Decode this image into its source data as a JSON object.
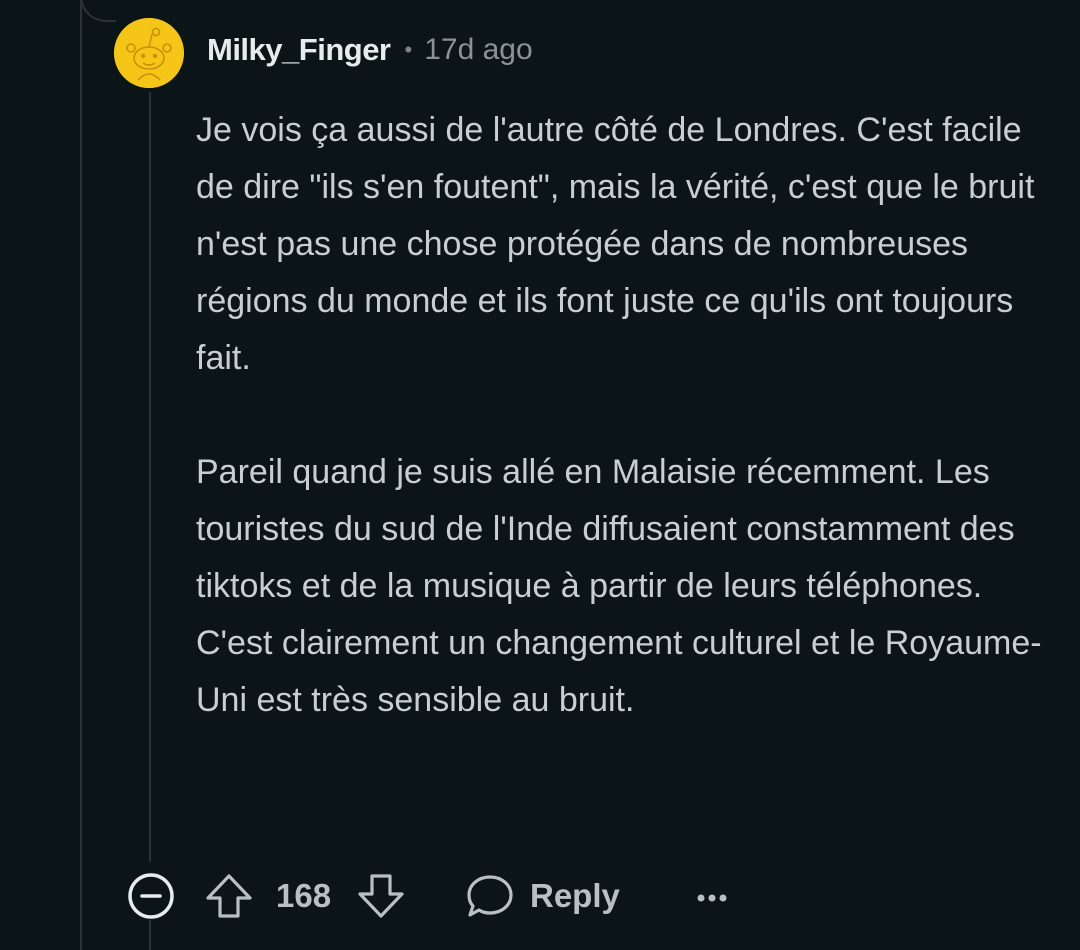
{
  "comment": {
    "author": "Milky_Finger",
    "separator": "•",
    "age": "17d ago",
    "paragraphs": [
      "Je vois ça aussi de l'autre côté de Londres. C'est facile de dire \"ils s'en foutent\", mais la vérité, c'est que le bruit n'est pas une chose protégée dans de nombreuses régions du monde et ils font juste ce qu'ils ont toujours fait.",
      "Pareil quand je suis allé en Malaisie récemment. Les touristes du sud de l'Inde diffusaient constamment des tiktoks et de la musique à partir de leurs téléphones. C'est clairement un changement culturel et le Royaume-Uni est très sensible au bruit."
    ]
  },
  "actions": {
    "score": "168",
    "reply_label": "Reply",
    "icons": {
      "collapse": "collapse-minus-icon",
      "upvote": "upvote-arrow-icon",
      "downvote": "downvote-arrow-icon",
      "reply": "speech-bubble-icon",
      "more": "more-options-icon"
    }
  },
  "colors": {
    "background": "#0b1416",
    "avatar_bg": "#f5c518",
    "text": "#c8cfd3",
    "muted": "#8a9296",
    "thread_line": "#2a3236"
  }
}
